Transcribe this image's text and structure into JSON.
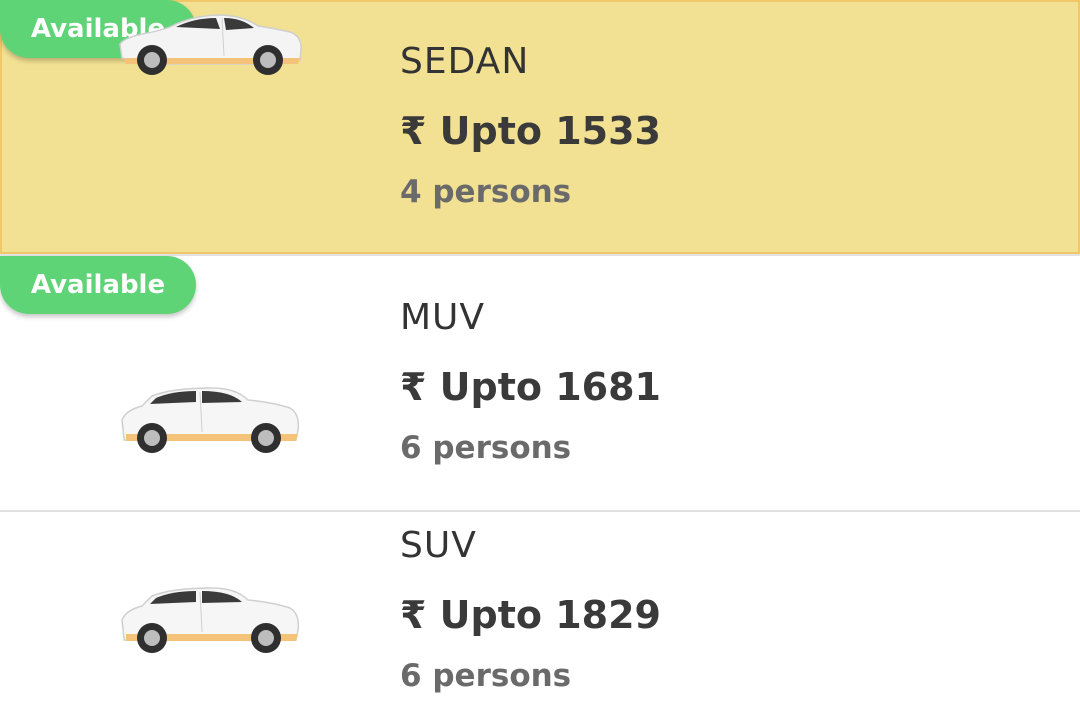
{
  "vehicles": [
    {
      "name": "SEDAN",
      "price": "₹ Upto 1533",
      "capacity": "4 persons",
      "badge": "Available",
      "selected": true,
      "icon": "sedan-car-icon"
    },
    {
      "name": "MUV",
      "price": "₹ Upto 1681",
      "capacity": "6 persons",
      "badge": "Available",
      "selected": false,
      "icon": "muv-car-icon"
    },
    {
      "name": "SUV",
      "price": "₹ Upto 1829",
      "capacity": "6 persons",
      "badge": "",
      "selected": false,
      "icon": "suv-car-icon"
    }
  ],
  "colors": {
    "selected_background": "#f2e193",
    "badge_green": "#5fd477",
    "car_trim": "#f5c27a"
  }
}
